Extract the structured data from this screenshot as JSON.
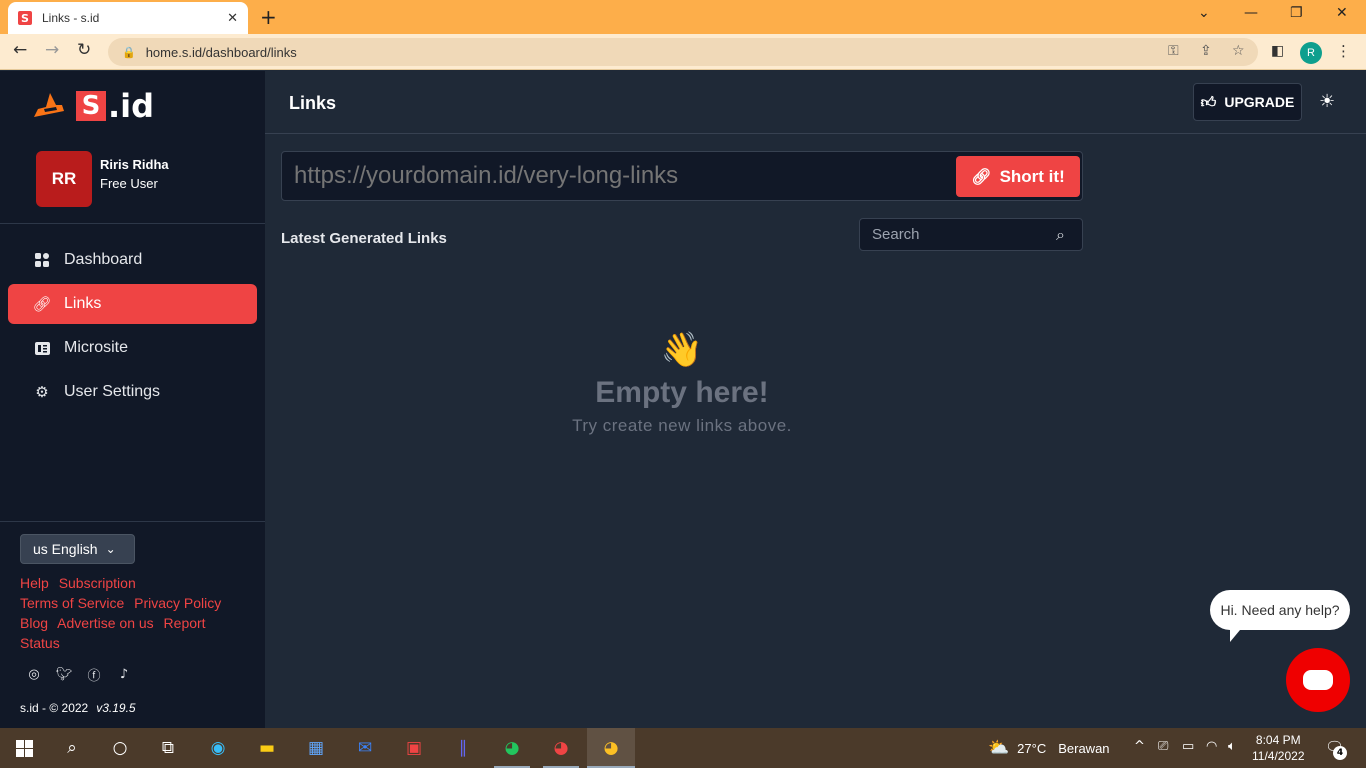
{
  "browser": {
    "tab_title": "Links - s.id",
    "tab_favicon": "S",
    "url": "home.s.id/dashboard/links",
    "profile_initial": "R"
  },
  "sidebar": {
    "logo_text": "S",
    "logo_suffix": ".id",
    "user": {
      "initials": "RR",
      "name": "Riris Ridha",
      "plan": "Free User"
    },
    "nav": [
      {
        "label": "Dashboard",
        "icon": "grid-icon"
      },
      {
        "label": "Links",
        "icon": "link-icon",
        "active": true
      },
      {
        "label": "Microsite",
        "icon": "microsite-icon"
      },
      {
        "label": "User Settings",
        "icon": "gear-icon"
      }
    ],
    "language": "us English",
    "footer_links": [
      "Help",
      "Subscription",
      "Terms of Service",
      "Privacy Policy",
      "Blog",
      "Advertise on us",
      "Report",
      "Status"
    ],
    "copyright": "s.id - © 2022",
    "version": "v3.19.5"
  },
  "header": {
    "title": "Links",
    "upgrade_label": "UPGRADE"
  },
  "shortener": {
    "placeholder": "https://yourdomain.id/very-long-links",
    "button_label": "Short it!"
  },
  "latest": {
    "title": "Latest Generated Links",
    "search_placeholder": "Search"
  },
  "empty": {
    "title": "Empty here!",
    "subtitle": "Try create new links above."
  },
  "chat": {
    "bubble_text": "Hi. Need any help?"
  },
  "taskbar": {
    "weather_temp": "27°C",
    "weather_text": "Berawan",
    "time": "8:04 PM",
    "date": "11/4/2022",
    "notification_count": "4"
  },
  "colors": {
    "accent": "#ef4444",
    "sidebar_bg": "#111827",
    "main_bg": "#1f2937",
    "browser_bar": "#fdae4a"
  }
}
